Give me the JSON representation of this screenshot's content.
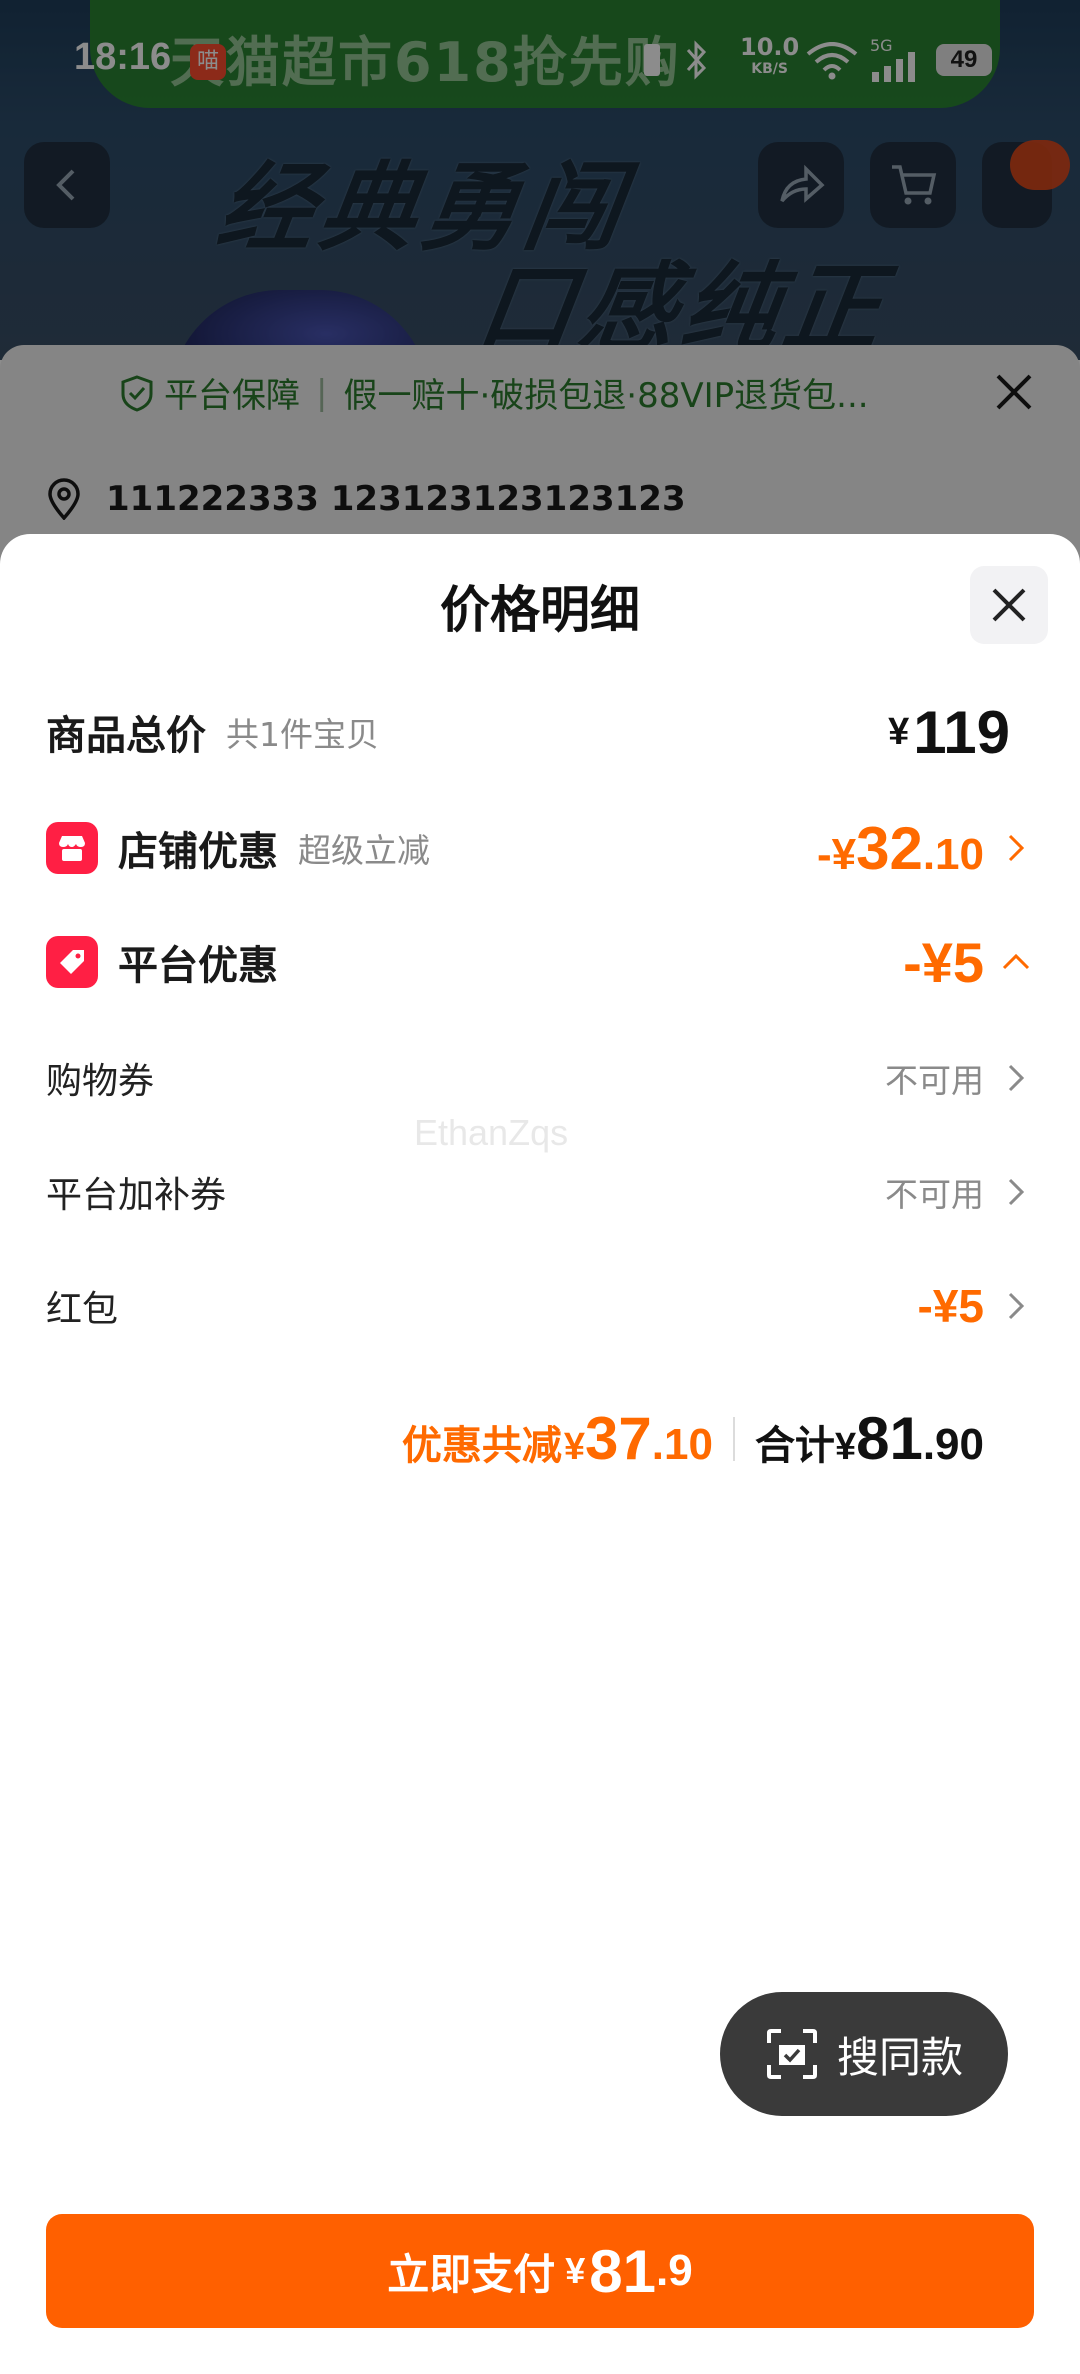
{
  "status_bar": {
    "time": "18:16",
    "app_badge": "喵",
    "net_speed": "10.0",
    "net_unit": "KB/S",
    "network": "5G",
    "battery": "49"
  },
  "background": {
    "banner_ad": "天猫超市618抢先购",
    "slogan_line1": "经典勇闯",
    "slogan_line2": "口感纯正",
    "guarantee_label": "平台保障",
    "guarantee_text": "假一赔十·破损包退·88VIP退货包...",
    "address": "111222333 123123123123123"
  },
  "sheet": {
    "title": "价格明细",
    "total_price": {
      "label": "商品总价",
      "sub": "共1件宝贝",
      "currency": "¥",
      "value": "119"
    },
    "store_discount": {
      "label": "店铺优惠",
      "sub": "超级立减",
      "prefix": "-¥",
      "int": "32",
      "dec": ".10"
    },
    "platform_discount": {
      "label": "平台优惠",
      "value": "-¥5"
    },
    "coupon_rows": [
      {
        "label": "购物券",
        "value": "不可用"
      },
      {
        "label": "平台加补券",
        "value": "不可用"
      },
      {
        "label": "红包",
        "value": "-¥5"
      }
    ],
    "watermark": "EthanZqs",
    "summary": {
      "discount_label": "优惠共减",
      "discount_currency": "¥",
      "discount_int": "37",
      "discount_dec": ".10",
      "total_label": "合计",
      "total_currency": "¥",
      "total_int": "81",
      "total_dec": ".90"
    }
  },
  "similar_button": "搜同款",
  "pay_button": {
    "label": "立即支付",
    "currency": "¥",
    "int": "81",
    "dec": ".9"
  },
  "colors": {
    "accent_orange": "#ff6a00",
    "pay_orange": "#ff6000",
    "tag_red": "#ff1f44"
  }
}
